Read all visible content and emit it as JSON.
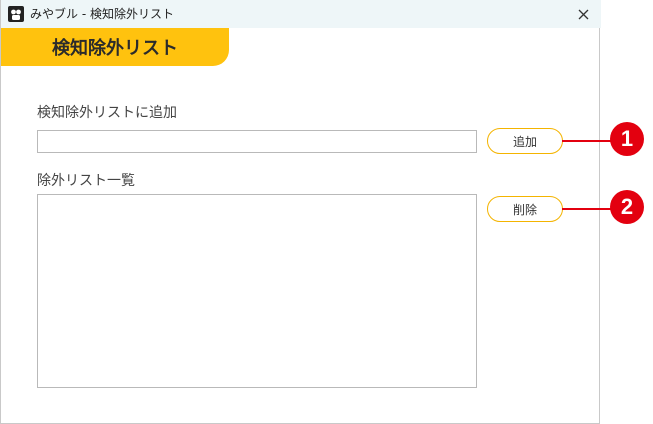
{
  "window": {
    "title": "みやブル - 検知除外リスト",
    "close_glyph": "✕",
    "icon": "app-logo-icon"
  },
  "header": {
    "title": "検知除外リスト"
  },
  "add_section": {
    "label": "検知除外リストに追加",
    "input_value": "",
    "button_label": "追加"
  },
  "list_section": {
    "label": "除外リスト一覧",
    "items": [],
    "button_label": "削除"
  },
  "callouts": [
    {
      "number": "1"
    },
    {
      "number": "2"
    }
  ],
  "colors": {
    "accent": "#ffc20e",
    "button_border": "#f4b400",
    "callout": "#e3000f",
    "titlebar": "#eef6f8"
  }
}
